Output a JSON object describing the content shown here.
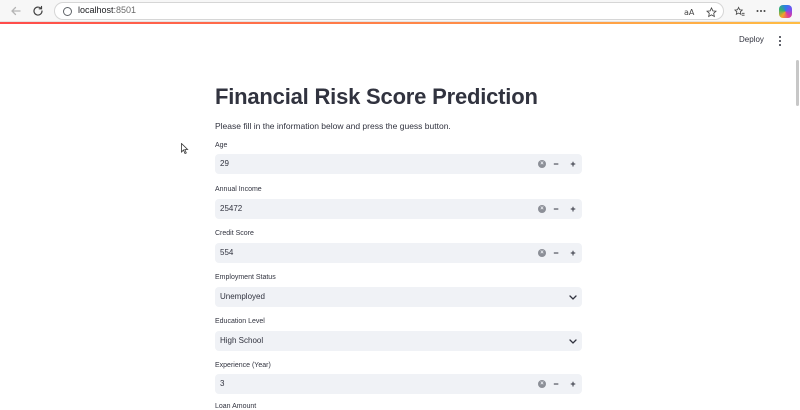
{
  "browser": {
    "url_host": "localhost",
    "url_port": ":8501"
  },
  "header": {
    "deploy_label": "Deploy"
  },
  "main": {
    "title": "Financial Risk Score Prediction",
    "subtitle": "Please fill in the information below and press the guess button.",
    "fields": [
      {
        "label": "Age",
        "type": "number",
        "value": "29"
      },
      {
        "label": "Annual Income",
        "type": "number",
        "value": "25472"
      },
      {
        "label": "Credit Score",
        "type": "number",
        "value": "554"
      },
      {
        "label": "Employment Status",
        "type": "select",
        "value": "Unemployed"
      },
      {
        "label": "Education Level",
        "type": "select",
        "value": "High School"
      },
      {
        "label": "Experience (Year)",
        "type": "number",
        "value": "3"
      }
    ],
    "next_label_partial": "Loan Amount"
  },
  "icons": {
    "back": "arrow-left-icon",
    "reload": "reload-icon",
    "info": "info-icon",
    "read_aloud": "read-aloud-icon",
    "favorite": "star-icon",
    "favorites_bar": "favorites-icon",
    "more": "more-icon",
    "copilot": "copilot-icon",
    "kebab": "kebab-menu-icon",
    "clear": "clear-x-icon",
    "minus": "minus-icon",
    "plus": "plus-icon",
    "chevron": "chevron-down-icon"
  },
  "colors": {
    "accent_start": "#ff4b4b",
    "accent_end": "#ffbd45",
    "input_bg": "#f0f2f6",
    "text": "#31333f"
  }
}
